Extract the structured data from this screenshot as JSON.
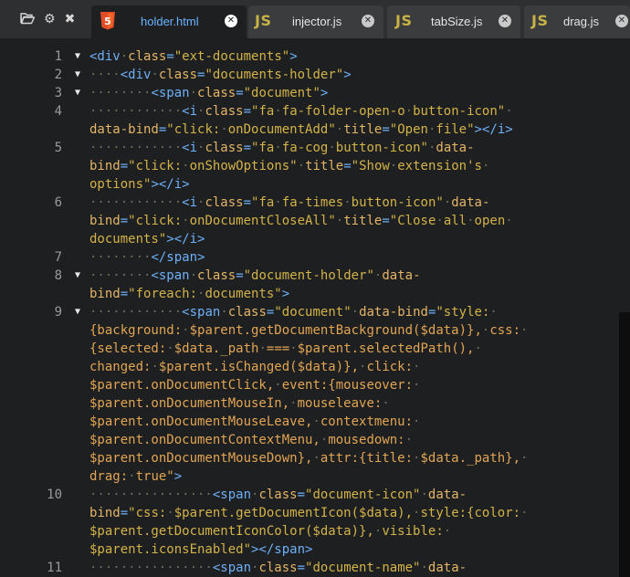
{
  "toolbar": {
    "open_icon": "folder-open-icon",
    "settings_icon": "gear-icon",
    "close_all_icon": "close-icon"
  },
  "tabs": [
    {
      "name": "holder.html",
      "icon": "html5-icon",
      "active": true
    },
    {
      "name": "injector.js",
      "icon": "js",
      "active": false
    },
    {
      "name": "tabSize.js",
      "icon": "js",
      "active": false
    },
    {
      "name": "drag.js",
      "icon": "js",
      "active": false
    }
  ],
  "editor": {
    "lines": [
      {
        "number": "1",
        "fold": true,
        "rows": [
          [
            [
              "tg",
              "<div"
            ],
            [
              "ws",
              "·"
            ],
            [
              "at",
              "class"
            ],
            [
              "tg",
              "="
            ],
            [
              "vl",
              "\"ext-documents\""
            ],
            [
              "tg",
              ">"
            ]
          ]
        ]
      },
      {
        "number": "2",
        "fold": true,
        "rows": [
          [
            [
              "ws",
              "····"
            ],
            [
              "tg",
              "<div"
            ],
            [
              "ws",
              "·"
            ],
            [
              "at",
              "class"
            ],
            [
              "tg",
              "="
            ],
            [
              "vl",
              "\"documents-holder\""
            ],
            [
              "tg",
              ">"
            ]
          ]
        ]
      },
      {
        "number": "3",
        "fold": true,
        "rows": [
          [
            [
              "ws",
              "········"
            ],
            [
              "tg",
              "<span"
            ],
            [
              "ws",
              "·"
            ],
            [
              "at",
              "class"
            ],
            [
              "tg",
              "="
            ],
            [
              "vl",
              "\"document\""
            ],
            [
              "tg",
              ">"
            ]
          ]
        ]
      },
      {
        "number": "4",
        "fold": false,
        "rows": [
          [
            [
              "ws",
              "············"
            ],
            [
              "tg",
              "<i"
            ],
            [
              "ws",
              "·"
            ],
            [
              "at",
              "class"
            ],
            [
              "tg",
              "="
            ],
            [
              "vl",
              "\"fa"
            ],
            [
              "ws",
              "·"
            ],
            [
              "vl",
              "fa-folder-open-o"
            ],
            [
              "ws",
              "·"
            ],
            [
              "vl",
              "button-icon\""
            ],
            [
              "ws",
              "·"
            ]
          ],
          [
            [
              "at",
              "data-bind"
            ],
            [
              "tg",
              "="
            ],
            [
              "vl",
              "\"click:"
            ],
            [
              "ws",
              "·"
            ],
            [
              "vl",
              "onDocumentAdd\""
            ],
            [
              "ws",
              "·"
            ],
            [
              "at",
              "title"
            ],
            [
              "tg",
              "="
            ],
            [
              "vl",
              "\"Open"
            ],
            [
              "ws",
              "·"
            ],
            [
              "vl",
              "file\""
            ],
            [
              "tg",
              "></i>"
            ]
          ]
        ]
      },
      {
        "number": "5",
        "fold": false,
        "rows": [
          [
            [
              "ws",
              "············"
            ],
            [
              "tg",
              "<i"
            ],
            [
              "ws",
              "·"
            ],
            [
              "at",
              "class"
            ],
            [
              "tg",
              "="
            ],
            [
              "vl",
              "\"fa"
            ],
            [
              "ws",
              "·"
            ],
            [
              "vl",
              "fa-cog"
            ],
            [
              "ws",
              "·"
            ],
            [
              "vl",
              "button-icon\""
            ],
            [
              "ws",
              "·"
            ],
            [
              "at",
              "data-"
            ]
          ],
          [
            [
              "at",
              "bind"
            ],
            [
              "tg",
              "="
            ],
            [
              "vl",
              "\"click:"
            ],
            [
              "ws",
              "·"
            ],
            [
              "vl",
              "onShowOptions\""
            ],
            [
              "ws",
              "·"
            ],
            [
              "at",
              "title"
            ],
            [
              "tg",
              "="
            ],
            [
              "vl",
              "\"Show"
            ],
            [
              "ws",
              "·"
            ],
            [
              "vl",
              "extension's"
            ],
            [
              "ws",
              "·"
            ]
          ],
          [
            [
              "vl",
              "options\""
            ],
            [
              "tg",
              "></i>"
            ]
          ]
        ]
      },
      {
        "number": "6",
        "fold": false,
        "rows": [
          [
            [
              "ws",
              "············"
            ],
            [
              "tg",
              "<i"
            ],
            [
              "ws",
              "·"
            ],
            [
              "at",
              "class"
            ],
            [
              "tg",
              "="
            ],
            [
              "vl",
              "\"fa"
            ],
            [
              "ws",
              "·"
            ],
            [
              "vl",
              "fa-times"
            ],
            [
              "ws",
              "·"
            ],
            [
              "vl",
              "button-icon\""
            ],
            [
              "ws",
              "·"
            ],
            [
              "at",
              "data-"
            ]
          ],
          [
            [
              "at",
              "bind"
            ],
            [
              "tg",
              "="
            ],
            [
              "vl",
              "\"click:"
            ],
            [
              "ws",
              "·"
            ],
            [
              "vl",
              "onDocumentCloseAll\""
            ],
            [
              "ws",
              "·"
            ],
            [
              "at",
              "title"
            ],
            [
              "tg",
              "="
            ],
            [
              "vl",
              "\"Close"
            ],
            [
              "ws",
              "·"
            ],
            [
              "vl",
              "all"
            ],
            [
              "ws",
              "·"
            ],
            [
              "vl",
              "open"
            ],
            [
              "ws",
              "·"
            ]
          ],
          [
            [
              "vl",
              "documents\""
            ],
            [
              "tg",
              "></i>"
            ]
          ]
        ]
      },
      {
        "number": "7",
        "fold": false,
        "rows": [
          [
            [
              "ws",
              "········"
            ],
            [
              "tg",
              "</span>"
            ]
          ]
        ]
      },
      {
        "number": "8",
        "fold": true,
        "rows": [
          [
            [
              "ws",
              "········"
            ],
            [
              "tg",
              "<span"
            ],
            [
              "ws",
              "·"
            ],
            [
              "at",
              "class"
            ],
            [
              "tg",
              "="
            ],
            [
              "vl",
              "\"document-holder\""
            ],
            [
              "ws",
              "·"
            ],
            [
              "at",
              "data-"
            ]
          ],
          [
            [
              "at",
              "bind"
            ],
            [
              "tg",
              "="
            ],
            [
              "vl",
              "\"foreach:"
            ],
            [
              "ws",
              "·"
            ],
            [
              "vl",
              "documents\""
            ],
            [
              "tg",
              ">"
            ]
          ]
        ]
      },
      {
        "number": "9",
        "fold": true,
        "rows": [
          [
            [
              "ws",
              "············"
            ],
            [
              "tg",
              "<span"
            ],
            [
              "ws",
              "·"
            ],
            [
              "at",
              "class"
            ],
            [
              "tg",
              "="
            ],
            [
              "vl",
              "\"document\""
            ],
            [
              "ws",
              "·"
            ],
            [
              "at",
              "data-bind"
            ],
            [
              "tg",
              "="
            ],
            [
              "vl",
              "\"style:"
            ],
            [
              "ws",
              "·"
            ]
          ],
          [
            [
              "pl",
              "{background:"
            ],
            [
              "ws",
              "·"
            ],
            [
              "pl",
              "$parent.getDocumentBackground($data)},"
            ],
            [
              "ws",
              "·"
            ],
            [
              "pl",
              "css:"
            ],
            [
              "ws",
              "·"
            ]
          ],
          [
            [
              "pl",
              "{selected:"
            ],
            [
              "ws",
              "·"
            ],
            [
              "pl",
              "$data._path"
            ],
            [
              "ws",
              "·"
            ],
            [
              "pl",
              "==="
            ],
            [
              "ws",
              "·"
            ],
            [
              "pl",
              "$parent.selectedPath(),"
            ],
            [
              "ws",
              "·"
            ]
          ],
          [
            [
              "pl",
              "changed:"
            ],
            [
              "ws",
              "·"
            ],
            [
              "pl",
              "$parent.isChanged($data)},"
            ],
            [
              "ws",
              "·"
            ],
            [
              "pl",
              "click:"
            ],
            [
              "ws",
              "·"
            ]
          ],
          [
            [
              "pl",
              "$parent.onDocumentClick,"
            ],
            [
              "ws",
              "·"
            ],
            [
              "pl",
              "event:{mouseover:"
            ],
            [
              "ws",
              "·"
            ]
          ],
          [
            [
              "pl",
              "$parent.onDocumentMouseIn,"
            ],
            [
              "ws",
              "·"
            ],
            [
              "pl",
              "mouseleave:"
            ],
            [
              "ws",
              "·"
            ]
          ],
          [
            [
              "pl",
              "$parent.onDocumentMouseLeave,"
            ],
            [
              "ws",
              "·"
            ],
            [
              "pl",
              "contextmenu:"
            ],
            [
              "ws",
              "·"
            ]
          ],
          [
            [
              "pl",
              "$parent.onDocumentContextMenu,"
            ],
            [
              "ws",
              "·"
            ],
            [
              "pl",
              "mousedown:"
            ],
            [
              "ws",
              "·"
            ]
          ],
          [
            [
              "pl",
              "$parent.onDocumentMouseDown},"
            ],
            [
              "ws",
              "·"
            ],
            [
              "pl",
              "attr:{title:"
            ],
            [
              "ws",
              "·"
            ],
            [
              "pl",
              "$data._path},"
            ],
            [
              "ws",
              "·"
            ]
          ],
          [
            [
              "pl",
              "drag:"
            ],
            [
              "ws",
              "·"
            ],
            [
              "pl",
              "true\""
            ],
            [
              "tg",
              ">"
            ]
          ]
        ]
      },
      {
        "number": "10",
        "fold": false,
        "rows": [
          [
            [
              "ws",
              "················"
            ],
            [
              "tg",
              "<span"
            ],
            [
              "ws",
              "·"
            ],
            [
              "at",
              "class"
            ],
            [
              "tg",
              "="
            ],
            [
              "vl",
              "\"document-icon\""
            ],
            [
              "ws",
              "·"
            ],
            [
              "at",
              "data-"
            ]
          ],
          [
            [
              "at",
              "bind"
            ],
            [
              "tg",
              "="
            ],
            [
              "vl",
              "\"css:"
            ],
            [
              "ws",
              "·"
            ],
            [
              "vl",
              "$parent.getDocumentIcon($data),"
            ],
            [
              "ws",
              "·"
            ],
            [
              "vl",
              "style:{color:"
            ],
            [
              "ws",
              "·"
            ]
          ],
          [
            [
              "vl",
              "$parent.getDocumentIconColor($data)},"
            ],
            [
              "ws",
              "·"
            ],
            [
              "vl",
              "visible:"
            ],
            [
              "ws",
              "·"
            ]
          ],
          [
            [
              "vl",
              "$parent.iconsEnabled\""
            ],
            [
              "tg",
              "></span>"
            ]
          ]
        ]
      },
      {
        "number": "11",
        "fold": false,
        "rows": [
          [
            [
              "ws",
              "················"
            ],
            [
              "tg",
              "<span"
            ],
            [
              "ws",
              "·"
            ],
            [
              "at",
              "class"
            ],
            [
              "tg",
              "="
            ],
            [
              "vl",
              "\"document-name\""
            ],
            [
              "ws",
              "·"
            ],
            [
              "at",
              "data-"
            ]
          ]
        ]
      }
    ]
  }
}
